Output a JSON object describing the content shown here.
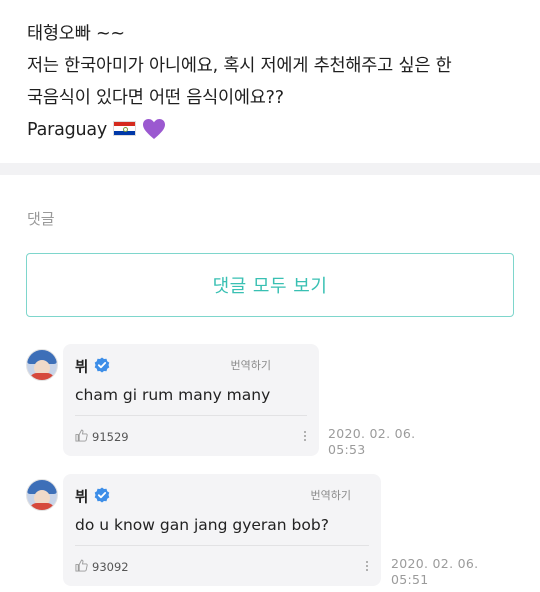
{
  "post": {
    "line1": "태형오빠 ~~",
    "line2": "저는 한국아미가 아니에요, 혹시 저에게 추천해주고 싶은 한",
    "line3": "국음식이 있다면 어떤 음식이에요??",
    "line4": "Paraguay",
    "flag_icon": "paraguay-flag",
    "heart_icon": "purple-heart",
    "heart_color": "#9b59d0"
  },
  "comments_section": {
    "title": "댓글",
    "view_all_label": "댓글 모두 보기",
    "accent_color": "#39c0b3"
  },
  "comments": [
    {
      "author": "뷔",
      "verified": true,
      "translate_label": "번역하기",
      "text": "cham gi rum many many",
      "likes": "91529",
      "date_line1": "2020. 02. 06.",
      "date_line2": "05:53"
    },
    {
      "author": "뷔",
      "verified": true,
      "translate_label": "번역하기",
      "text": "do u know gan jang gyeran bob?",
      "likes": "93092",
      "date_line1": "2020. 02. 06.",
      "date_line2": "05:51"
    }
  ]
}
